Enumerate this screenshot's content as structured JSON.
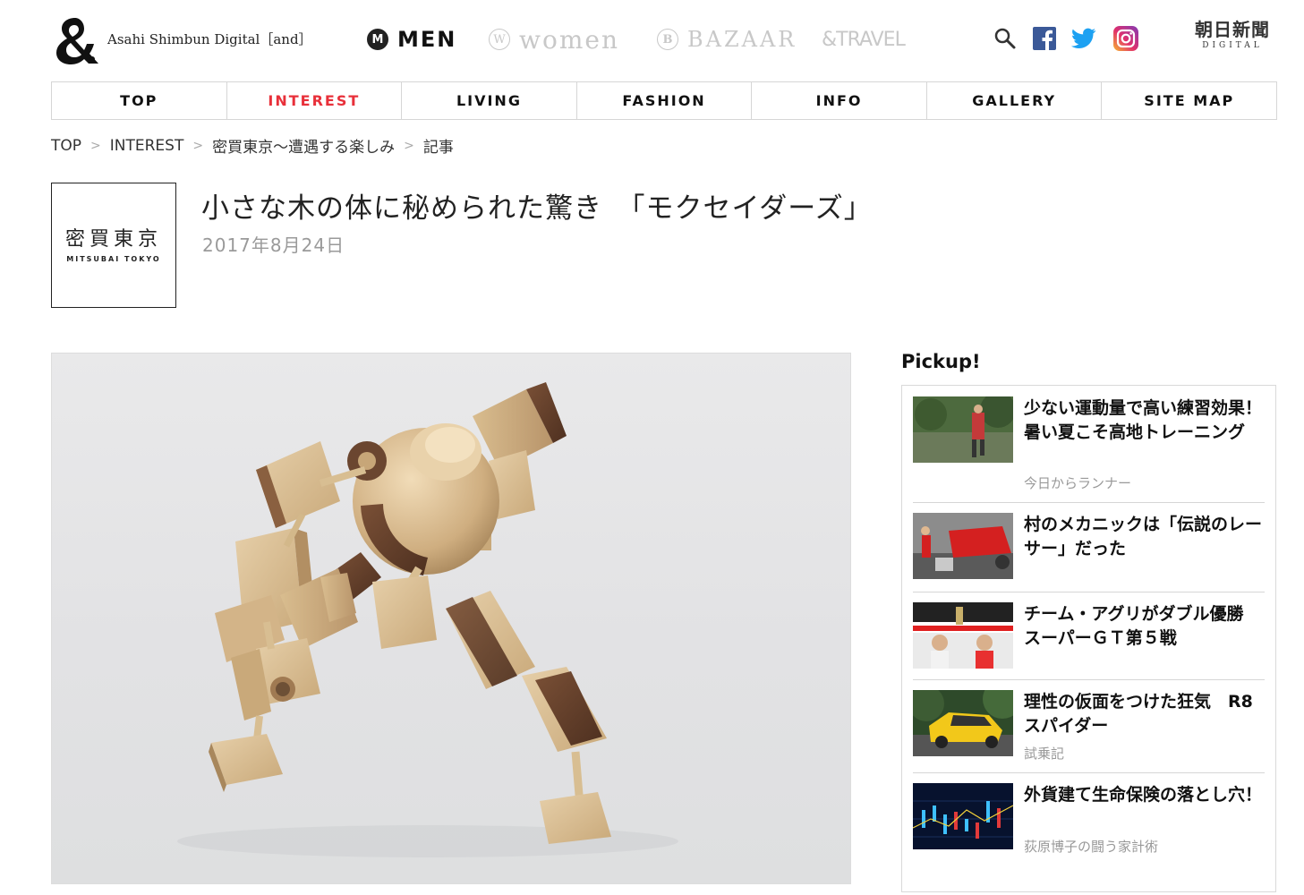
{
  "header": {
    "site_name": "Asahi Shimbun Digital［and］",
    "brands": {
      "men": {
        "mark": "M",
        "label": "MEN"
      },
      "women": {
        "mark": "W",
        "label": "women"
      },
      "bazaar": {
        "mark": "B",
        "label": "BAZAAR"
      },
      "travel": {
        "label": "&TRAVEL"
      }
    },
    "asahi_logo": {
      "jp": "朝日新聞",
      "en": "DIGITAL"
    },
    "social": [
      "facebook-icon",
      "twitter-icon",
      "instagram-icon"
    ],
    "colors": {
      "facebook": "#3b5998",
      "twitter": "#1da1f2",
      "instagram": "#c13584",
      "accent": "#e8303a"
    }
  },
  "nav": {
    "items": [
      {
        "label": "TOP",
        "active": false
      },
      {
        "label": "INTEREST",
        "active": true
      },
      {
        "label": "LIVING",
        "active": false
      },
      {
        "label": "FASHION",
        "active": false
      },
      {
        "label": "INFO",
        "active": false
      },
      {
        "label": "GALLERY",
        "active": false
      },
      {
        "label": "SITE MAP",
        "active": false
      }
    ]
  },
  "breadcrumb": [
    "TOP",
    "INTEREST",
    "密買東京〜遭遇する楽しみ",
    "記事"
  ],
  "article": {
    "series_logo": {
      "jp": "密買東京",
      "en": "MITSUBAI TOKYO"
    },
    "title": "小さな木の体に秘められた驚き　「モクセイダーズ」",
    "date": "2017年8月24日"
  },
  "pickup": {
    "heading": "Pickup!",
    "items": [
      {
        "title": "少ない運動量で高い練習効果！ 暑い夏こそ高地トレーニング",
        "sub": "今日からランナー"
      },
      {
        "title": "村のメカニックは「伝説のレーサー」だった",
        "sub": ""
      },
      {
        "title": "チーム・アグリがダブル優勝　スーパーＧＴ第５戦",
        "sub": ""
      },
      {
        "title": "理性の仮面をつけた狂気　R8スパイダー",
        "sub": "試乗記"
      },
      {
        "title": "外貨建て生命保険の落とし穴！",
        "sub": "荻原博子の闘う家計術"
      }
    ]
  }
}
